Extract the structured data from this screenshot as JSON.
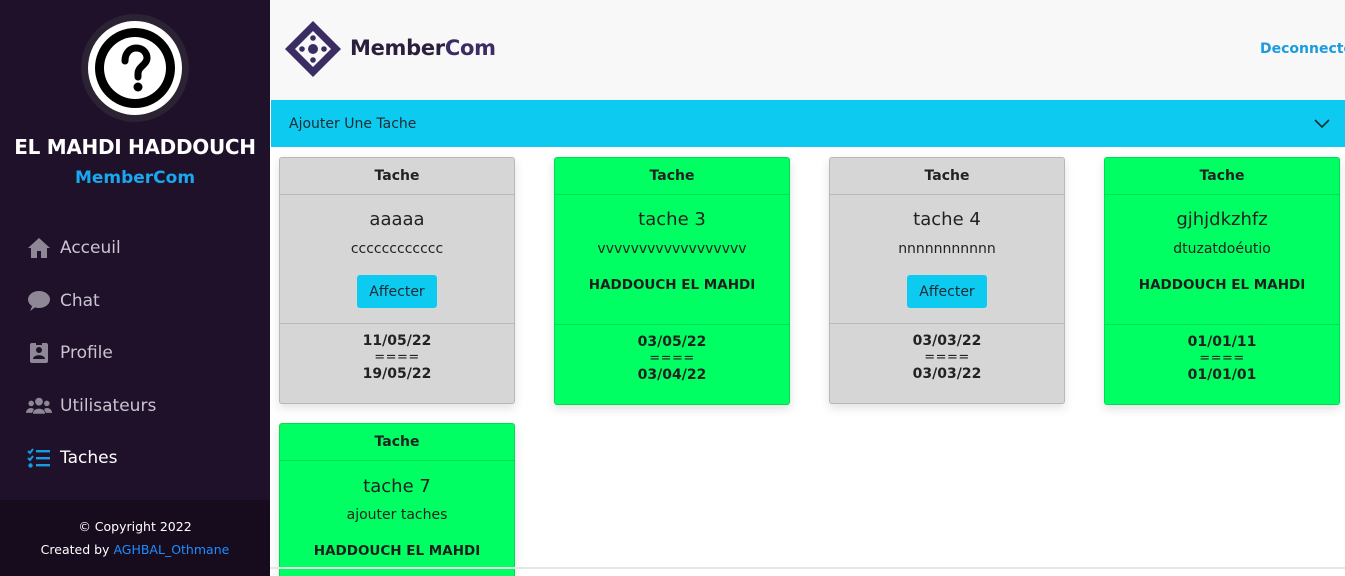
{
  "sidebar": {
    "user_name": "EL MAHDI HADDOUCH",
    "brand": "MemberCom",
    "items": [
      {
        "label": "Acceuil",
        "icon": "home-icon"
      },
      {
        "label": "Chat",
        "icon": "chat-icon"
      },
      {
        "label": "Profile",
        "icon": "profile-icon"
      },
      {
        "label": "Utilisateurs",
        "icon": "users-icon"
      },
      {
        "label": "Taches",
        "icon": "tasks-icon",
        "active": true
      }
    ],
    "footer": {
      "copyright": "© Copyright 2022",
      "created_by": "Created by",
      "author": "AGHBAL_Othmane"
    }
  },
  "header": {
    "logo_text_a": "Member",
    "logo_text_b": "Com",
    "logout_label": "Deconnecte"
  },
  "accordion": {
    "label": "Ajouter Une Tache"
  },
  "colors": {
    "sidebar_bg": "#1e1129",
    "accent_cyan": "#0dcaf0",
    "done_green": "#00ff62",
    "pending_gray": "#d6d6d6",
    "brand_blue": "#19a8ef"
  },
  "tasks": [
    {
      "header": "Tache",
      "title": "aaaaa",
      "description": "cccccccccccc",
      "button": "Affecter",
      "date_start": "11/05/22",
      "separator": "====",
      "date_end": "19/05/22",
      "status": "pending"
    },
    {
      "header": "Tache",
      "title": "tache 3",
      "description": "vvvvvvvvvvvvvvvvvv",
      "assignee": "HADDOUCH EL MAHDI",
      "date_start": "03/05/22",
      "separator": "====",
      "date_end": "03/04/22",
      "status": "assigned"
    },
    {
      "header": "Tache",
      "title": "tache 4",
      "description": "nnnnnnnnnnn",
      "button": "Affecter",
      "date_start": "03/03/22",
      "separator": "====",
      "date_end": "03/03/22",
      "status": "pending"
    },
    {
      "header": "Tache",
      "title": "gjhjdkzhfz",
      "description": "dtuzatdoéutio",
      "assignee": "HADDOUCH EL MAHDI",
      "date_start": "01/01/11",
      "separator": "====",
      "date_end": "01/01/01",
      "status": "assigned"
    },
    {
      "header": "Tache",
      "title": "tache 7",
      "description": "ajouter taches",
      "assignee": "HADDOUCH EL MAHDI",
      "status": "assigned"
    }
  ]
}
